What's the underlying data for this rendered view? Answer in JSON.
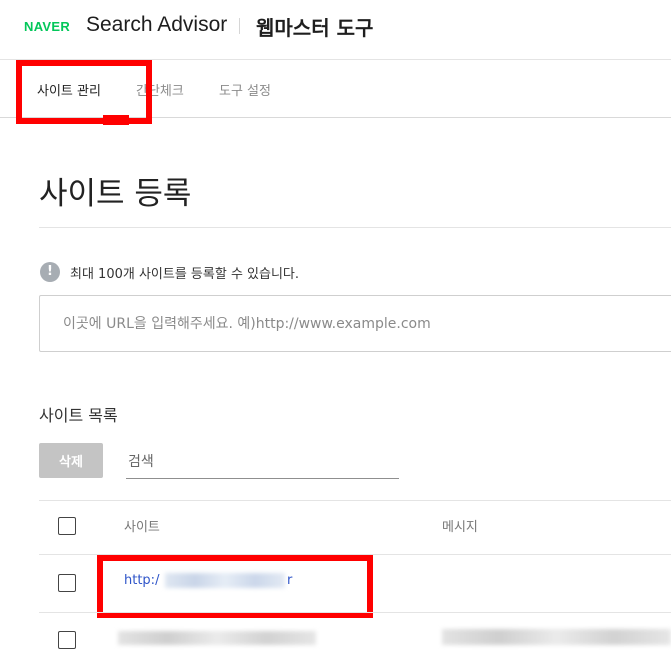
{
  "header": {
    "logo": "NAVER",
    "product": "Search Advisor",
    "tool_title": "웹마스터 도구"
  },
  "tabs": [
    {
      "label": "사이트 관리",
      "active": true
    },
    {
      "label": "간단체크",
      "active": false
    },
    {
      "label": "도구 설정",
      "active": false
    }
  ],
  "page": {
    "title": "사이트 등록",
    "info_icon": "info-icon",
    "info_text": "최대 100개 사이트를 등록할 수 있습니다.",
    "url_placeholder": "이곳에 URL을 입력해주세요. 예)http://www.example.com"
  },
  "site_list": {
    "title": "사이트 목록",
    "delete_label": "삭제",
    "search_placeholder": "검색",
    "columns": [
      "사이트",
      "메시지"
    ],
    "rows": [
      {
        "site_visible": "http:/",
        "site_tail": "r",
        "message": ""
      },
      {
        "site_visible": "",
        "site_tail": "",
        "message": ""
      }
    ]
  },
  "colors": {
    "brand": "#03c75a",
    "highlight": "#ff0000",
    "link": "#2f55c9"
  }
}
